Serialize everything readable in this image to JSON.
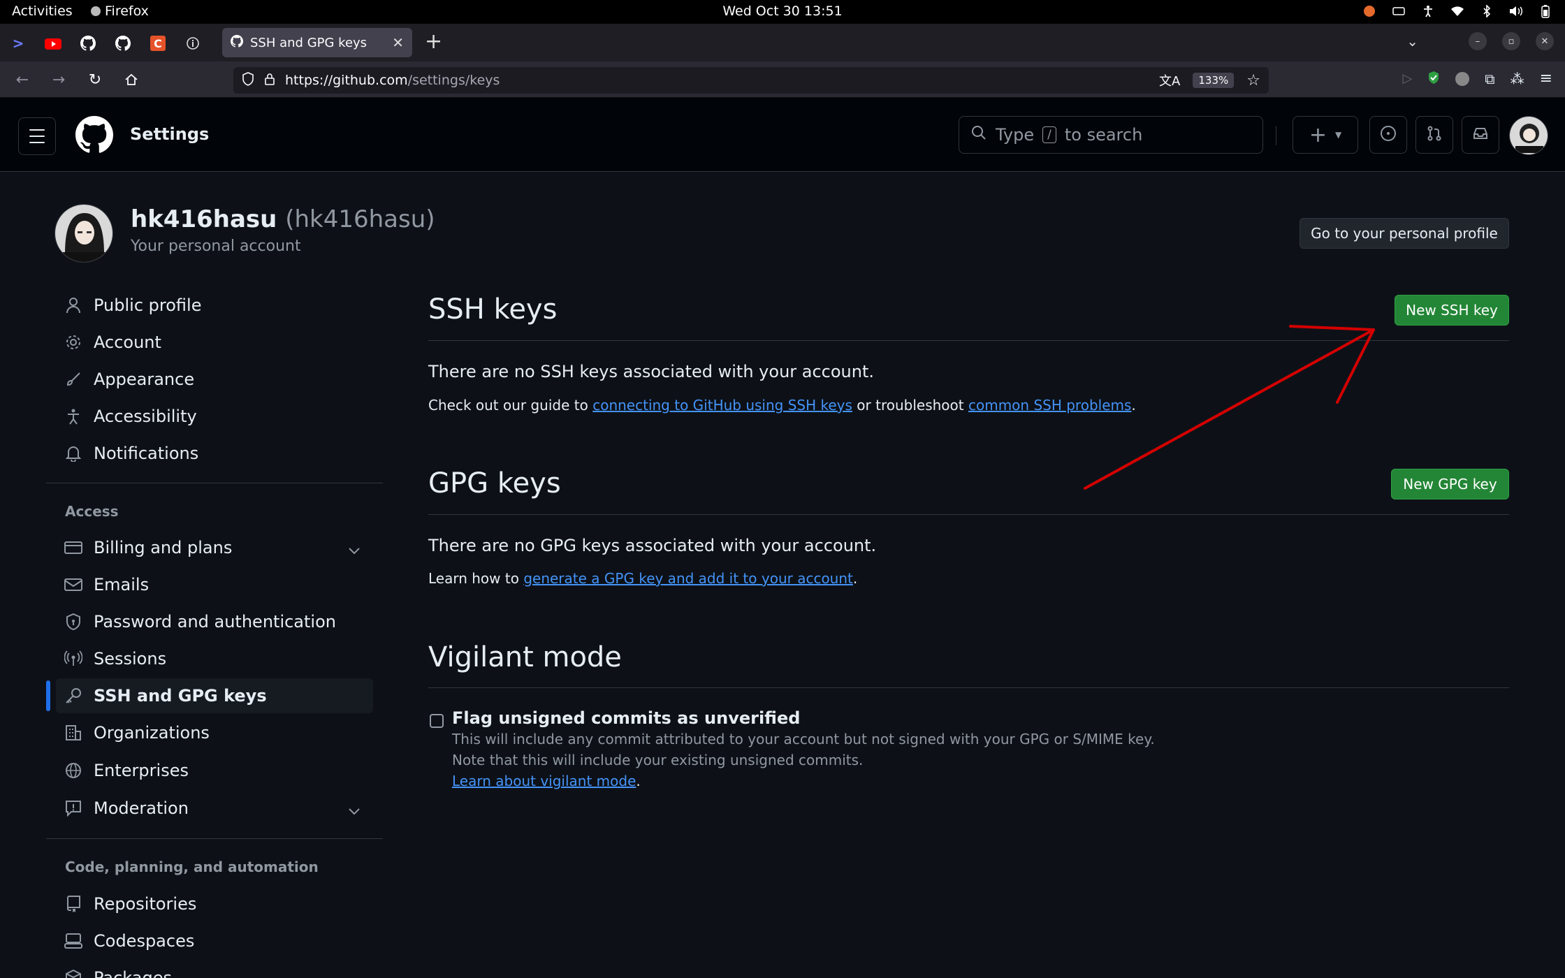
{
  "gnome": {
    "activities": "Activities",
    "app_name": "Firefox",
    "clock": "Wed Oct 30  13:51",
    "tray_icons": [
      "firefox-icon",
      "keyboard-icon",
      "accessibility-icon",
      "wifi-icon",
      "bluetooth-icon",
      "volume-icon",
      "battery-icon"
    ]
  },
  "browser": {
    "tab_title": "SSH and GPG keys",
    "url_host": "https://github.com",
    "url_path": "/settings/keys",
    "zoom": "133%",
    "pinned_tabs": [
      "terminal-icon",
      "youtube-icon",
      "github-icon",
      "github-icon",
      "coursera-icon",
      "info-icon"
    ]
  },
  "header": {
    "title": "Settings",
    "search_placeholder_prefix": "Type",
    "search_key": "/",
    "search_placeholder_suffix": "to search"
  },
  "profile": {
    "username": "hk416hasu",
    "handle": "(hk416hasu)",
    "subtitle": "Your personal account",
    "go_profile_button": "Go to your personal profile"
  },
  "sidebar": {
    "items": [
      {
        "label": "Public profile",
        "icon": "person-icon"
      },
      {
        "label": "Account",
        "icon": "gear-icon"
      },
      {
        "label": "Appearance",
        "icon": "paintbrush-icon"
      },
      {
        "label": "Accessibility",
        "icon": "accessibility-icon"
      },
      {
        "label": "Notifications",
        "icon": "bell-icon"
      }
    ],
    "access_heading": "Access",
    "access_items": [
      {
        "label": "Billing and plans",
        "icon": "credit-card-icon"
      },
      {
        "label": "Emails",
        "icon": "mail-icon"
      },
      {
        "label": "Password and authentication",
        "icon": "shield-lock-icon"
      },
      {
        "label": "Sessions",
        "icon": "broadcast-icon"
      },
      {
        "label": "SSH and GPG keys",
        "icon": "key-icon"
      },
      {
        "label": "Organizations",
        "icon": "organization-icon"
      },
      {
        "label": "Enterprises",
        "icon": "globe-icon"
      },
      {
        "label": "Moderation",
        "icon": "report-icon"
      }
    ],
    "code_heading": "Code, planning, and automation",
    "code_items": [
      {
        "label": "Repositories",
        "icon": "repo-icon"
      },
      {
        "label": "Codespaces",
        "icon": "codespaces-icon"
      },
      {
        "label": "Packages",
        "icon": "package-icon"
      }
    ]
  },
  "ssh": {
    "title": "SSH keys",
    "new_button": "New SSH key",
    "empty": "There are no SSH keys associated with your account.",
    "guide_prefix": "Check out our guide to ",
    "guide_link": "connecting to GitHub using SSH keys",
    "guide_middle": " or troubleshoot ",
    "guide_link2": "common SSH problems",
    "guide_suffix": "."
  },
  "gpg": {
    "title": "GPG keys",
    "new_button": "New GPG key",
    "empty": "There are no GPG keys associated with your account.",
    "learn_prefix": "Learn how to ",
    "learn_link": "generate a GPG key and add it to your account",
    "learn_suffix": "."
  },
  "vigilant": {
    "title": "Vigilant mode",
    "checkbox_label": "Flag unsigned commits as unverified",
    "note1": "This will include any commit attributed to your account but not signed with your GPG or S/MIME key.",
    "note2": "Note that this will include your existing unsigned commits.",
    "learn_link": "Learn about vigilant mode",
    "learn_suffix": "."
  },
  "colors": {
    "page_bg": "#0d1117",
    "header_bg": "#010409",
    "accent_green": "#238636",
    "link_blue": "#4493f8",
    "active_bar": "#1f6feb",
    "annotation_red": "#d40000"
  }
}
